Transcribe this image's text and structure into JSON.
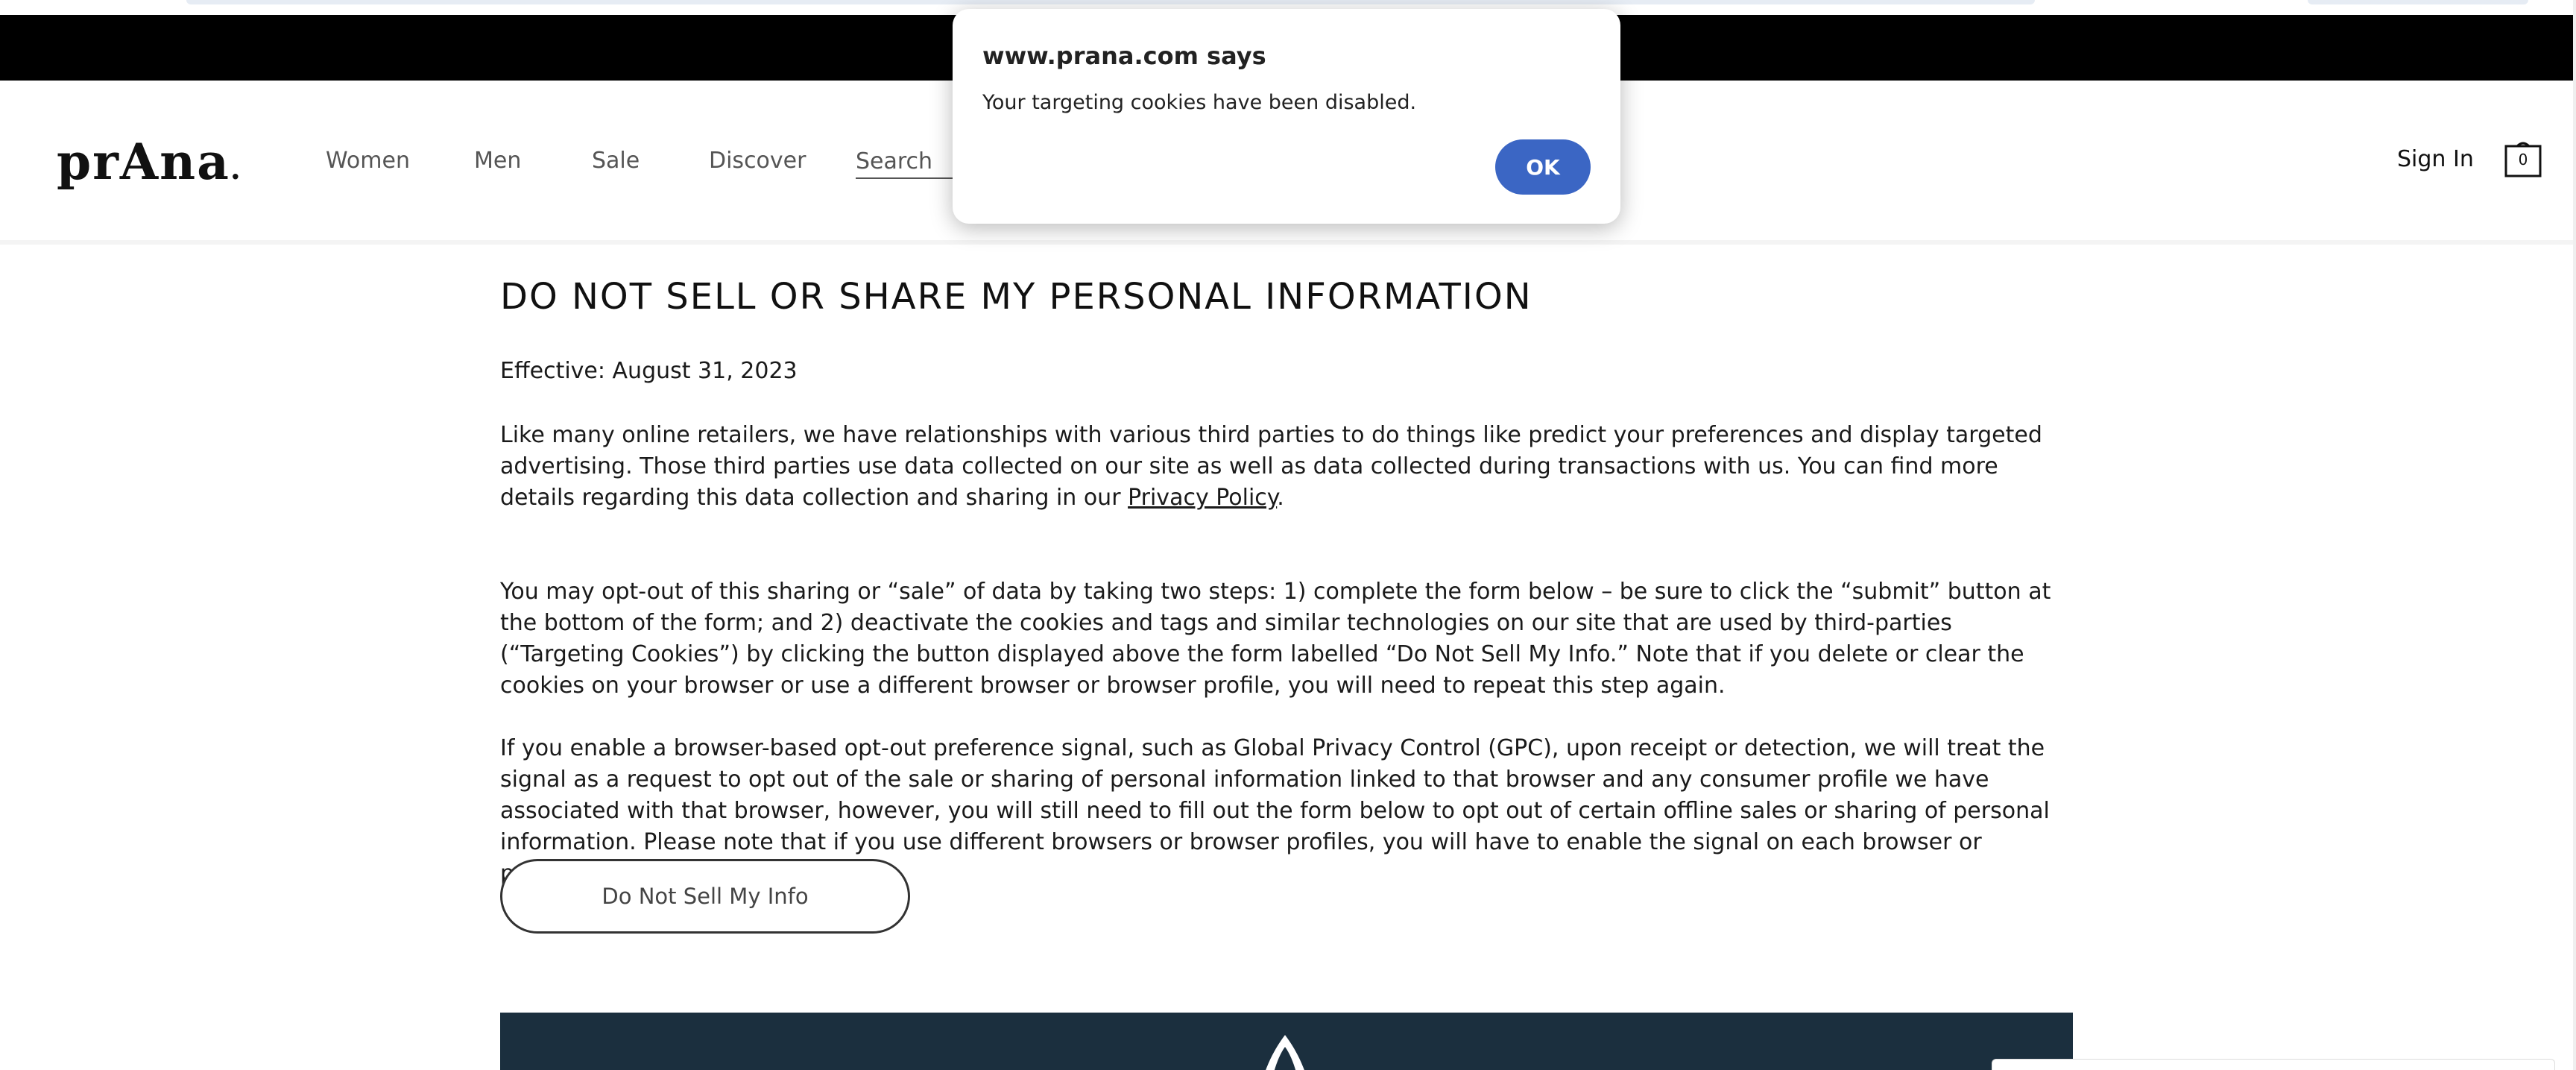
{
  "header": {
    "logo_text": "prAna",
    "logo_dot": ".",
    "nav": [
      {
        "label": "Women"
      },
      {
        "label": "Men"
      },
      {
        "label": "Sale"
      },
      {
        "label": "Discover"
      }
    ],
    "search_placeholder": "Search",
    "sign_in": "Sign In",
    "cart_count": "0"
  },
  "main": {
    "title": "DO NOT SELL OR SHARE MY PERSONAL INFORMATION",
    "effective": "Effective: August 31, 2023",
    "para1_before": "Like many online retailers, we have relationships with various third parties to do things like predict your preferences and display targeted advertising. Those third parties use data collected on our site as well as data collected during transactions with us. You can find more details regarding this data collection and sharing in our ",
    "para1_link": "Privacy Policy",
    "para1_after": ".",
    "para2": "You may opt-out of this sharing or “sale” of data by taking two steps: 1) complete the form below – be sure to click the “submit” button at the bottom of the form; and 2) deactivate the cookies and tags and similar technologies on our site that are used by third-parties (“Targeting Cookies”) by clicking the button displayed above the form labelled “Do Not Sell My Info.” Note that if you delete or clear the cookies on your browser or use a different browser or browser profile, you will need to repeat this step again.",
    "para3": "If you enable a browser-based opt-out preference signal, such as Global Privacy Control (GPC), upon receipt or detection, we will treat the signal as a request to opt out of the sale or sharing of personal information linked to that browser and any consumer profile we have associated with that browser, however, you will still need to fill out the form below to opt out of certain offline sales or sharing of personal information. Please note that if you use different browsers or browser profiles, you will have to enable the signal on each browser or profile.",
    "button_label": "Do Not Sell My Info"
  },
  "dialog": {
    "title": "www.prana.com says",
    "message": "Your targeting cookies have been disabled.",
    "ok_label": "OK"
  },
  "colors": {
    "promo_bar": "#000000",
    "banner": "#1b2f3e",
    "ok_button": "#3b66c4"
  }
}
